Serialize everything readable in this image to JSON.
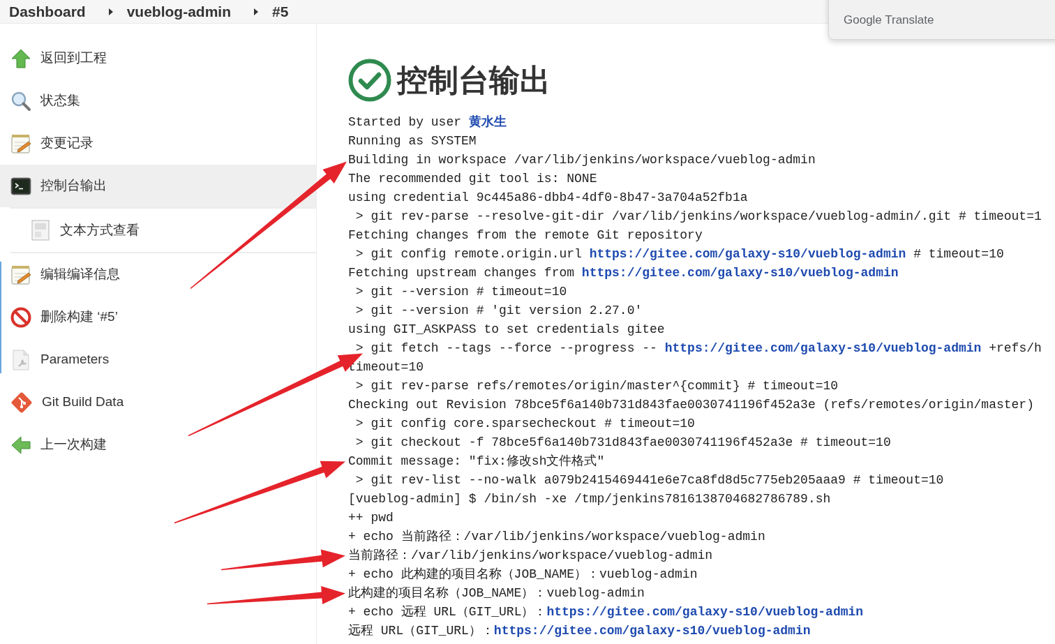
{
  "breadcrumb": [
    {
      "label": "Dashboard"
    },
    {
      "label": "vueblog-admin"
    },
    {
      "label": "#5"
    }
  ],
  "sidebar": {
    "items": [
      {
        "label": "返回到工程",
        "selected": false
      },
      {
        "label": "状态集",
        "selected": false
      },
      {
        "label": "变更记录",
        "selected": false
      },
      {
        "label": "控制台输出",
        "selected": true,
        "children": [
          {
            "label": "文本方式查看",
            "selected": false
          }
        ]
      },
      {
        "label": "编辑编译信息",
        "selected": false
      },
      {
        "label": "删除构建 ‘#5’",
        "selected": false
      },
      {
        "label": "Parameters",
        "selected": false
      },
      {
        "label": "Git Build Data",
        "selected": false
      },
      {
        "label": "上一次构建",
        "selected": false
      }
    ]
  },
  "page_title": {
    "text": "控制台输出"
  },
  "console": {
    "lines": [
      {
        "text": "Started by user ",
        "link": "黄水生",
        "annotated": false
      },
      {
        "text": "Running as SYSTEM",
        "annotated": false
      },
      {
        "text": "Building in workspace /var/lib/jenkins/workspace/vueblog-admin",
        "annotated": true
      },
      {
        "text": "The recommended git tool is: NONE",
        "annotated": false
      },
      {
        "text": "using credential 9c445a86-dbb4-4df0-8b47-3a704a52fb1a",
        "annotated": false
      },
      {
        "text": " > git rev-parse --resolve-git-dir /var/lib/jenkins/workspace/vueblog-admin/.git # timeout=1",
        "annotated": false
      },
      {
        "text": "Fetching changes from the remote Git repository",
        "annotated": false
      },
      {
        "text": " > git config remote.origin.url ",
        "link": "https://gitee.com/galaxy-s10/vueblog-admin",
        "rest": " # timeout=10",
        "annotated": false
      },
      {
        "text": "Fetching upstream changes from ",
        "link": "https://gitee.com/galaxy-s10/vueblog-admin",
        "annotated": false
      },
      {
        "text": " > git --version # timeout=10",
        "annotated": false
      },
      {
        "text": " > git --version # 'git version 2.27.0'",
        "annotated": false
      },
      {
        "text": "using GIT_ASKPASS to set credentials gitee",
        "annotated": false
      },
      {
        "text": " > git fetch --tags --force --progress -- ",
        "link": "https://gitee.com/galaxy-s10/vueblog-admin",
        "rest": " +refs/h",
        "annotated": true
      },
      {
        "text": "timeout=10",
        "annotated": false
      },
      {
        "text": " > git rev-parse refs/remotes/origin/master^{commit} # timeout=10",
        "annotated": false
      },
      {
        "text": "Checking out Revision 78bce5f6a140b731d843fae0030741196f452a3e (refs/remotes/origin/master)",
        "annotated": false
      },
      {
        "text": " > git config core.sparsecheckout # timeout=10",
        "annotated": false
      },
      {
        "text": " > git checkout -f 78bce5f6a140b731d843fae0030741196f452a3e # timeout=10",
        "annotated": false
      },
      {
        "text": "Commit message: \"fix:修改sh文件格式\"",
        "annotated": true
      },
      {
        "text": " > git rev-list --no-walk a079b2415469441e6e7ca8fd8d5c775eb205aaa9 # timeout=10",
        "annotated": false
      },
      {
        "text": "[vueblog-admin] $ /bin/sh -xe /tmp/jenkins7816138704682786789.sh",
        "annotated": false
      },
      {
        "text": "++ pwd",
        "annotated": false
      },
      {
        "text": "+ echo 当前路径：/var/lib/jenkins/workspace/vueblog-admin",
        "annotated": false
      },
      {
        "text": "当前路径：/var/lib/jenkins/workspace/vueblog-admin",
        "annotated": true
      },
      {
        "text": "+ echo 此构建的项目名称（JOB_NAME）：vueblog-admin",
        "annotated": false
      },
      {
        "text": "此构建的项目名称（JOB_NAME）：vueblog-admin",
        "annotated": true
      },
      {
        "text": "+ echo 远程 URL（GIT_URL）：",
        "link": "https://gitee.com/galaxy-s10/vueblog-admin",
        "annotated": false
      },
      {
        "text": "远程 URL（GIT_URL）：",
        "link": "https://gitee.com/galaxy-s10/vueblog-admin",
        "annotated": false
      }
    ]
  },
  "translate_popup": {
    "label": "Google Translate"
  }
}
